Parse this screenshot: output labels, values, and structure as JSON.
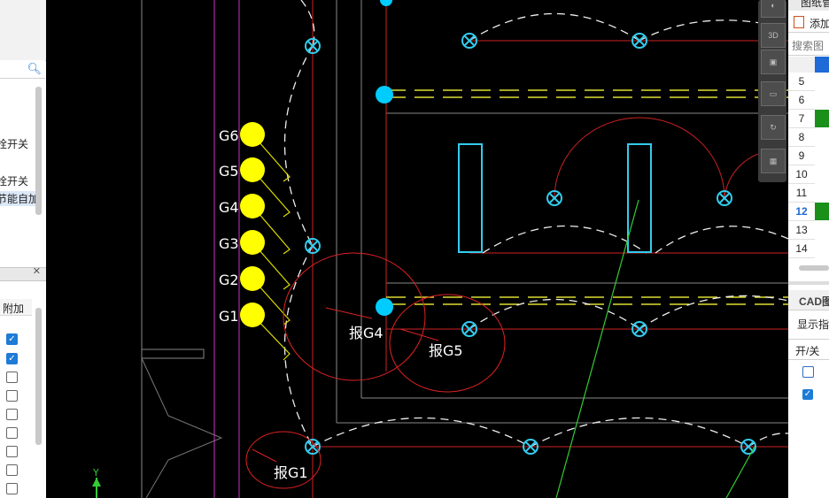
{
  "left_panel": {
    "items": [
      "栓开关",
      "栓开关",
      "节能自加"
    ],
    "column_header": "附加",
    "checkboxes": [
      true,
      true,
      false,
      false,
      false,
      false,
      false,
      false,
      false
    ]
  },
  "canvas": {
    "labels": {
      "g6": "G6",
      "g5": "G5",
      "g4": "G4",
      "g3": "G3",
      "g2": "G2",
      "g1": "G1",
      "bc4": "报G4",
      "bc5": "报G5",
      "bc1": "报G1"
    },
    "axis_label": "Y"
  },
  "toolbar": {
    "zoom_label": "3D"
  },
  "right_panel": {
    "title": "图纸管",
    "add_label": "添加",
    "search_placeholder": "搜索图",
    "rows": [
      "5",
      "6",
      "7",
      "8",
      "9",
      "10",
      "11",
      "12",
      "13",
      "14"
    ],
    "green_rows": [
      "7",
      "12"
    ],
    "selected_row": "12",
    "cad_section": "CAD图",
    "hint": "显示指",
    "onoff_header": "开/关"
  },
  "colors": {
    "background": "#000000",
    "accent_cyan": "#00ccff",
    "yellow": "#ffff00",
    "red": "#dd2222",
    "green": "#33cc33",
    "magenta": "#cc33cc"
  }
}
